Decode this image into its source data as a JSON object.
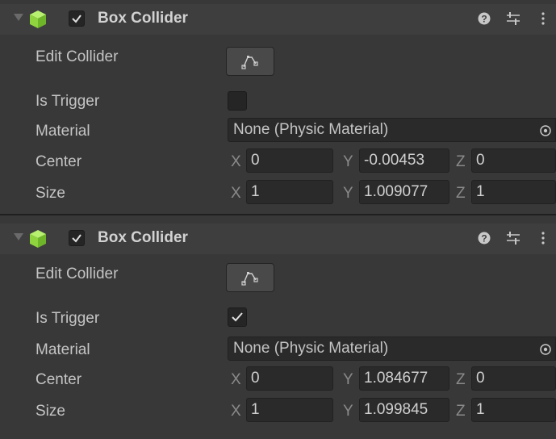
{
  "components": [
    {
      "title": "Box Collider",
      "enabled": true,
      "edit_label": "Edit Collider",
      "trigger_label": "Is Trigger",
      "is_trigger": false,
      "material_label": "Material",
      "material_value": "None (Physic Material)",
      "center_label": "Center",
      "center": {
        "x": "0",
        "y": "-0.00453",
        "z": "0"
      },
      "size_label": "Size",
      "size": {
        "x": "1",
        "y": "1.009077",
        "z": "1"
      }
    },
    {
      "title": "Box Collider",
      "enabled": true,
      "edit_label": "Edit Collider",
      "trigger_label": "Is Trigger",
      "is_trigger": true,
      "material_label": "Material",
      "material_value": "None (Physic Material)",
      "center_label": "Center",
      "center": {
        "x": "0",
        "y": "1.084677",
        "z": "0"
      },
      "size_label": "Size",
      "size": {
        "x": "1",
        "y": "1.099845",
        "z": "1"
      }
    }
  ],
  "axis_labels": {
    "x": "X",
    "y": "Y",
    "z": "Z"
  },
  "icons": {
    "component": "box-collider-cube-icon",
    "help": "help-icon",
    "preset": "preset-sliders-icon",
    "menu": "kebab-menu-icon",
    "edit": "edit-collider-icon",
    "picker": "object-picker-icon"
  },
  "colors": {
    "cube_green": "#9be24f",
    "panel": "#383838",
    "header": "#3e3e3e",
    "field": "#2a2a2a"
  }
}
